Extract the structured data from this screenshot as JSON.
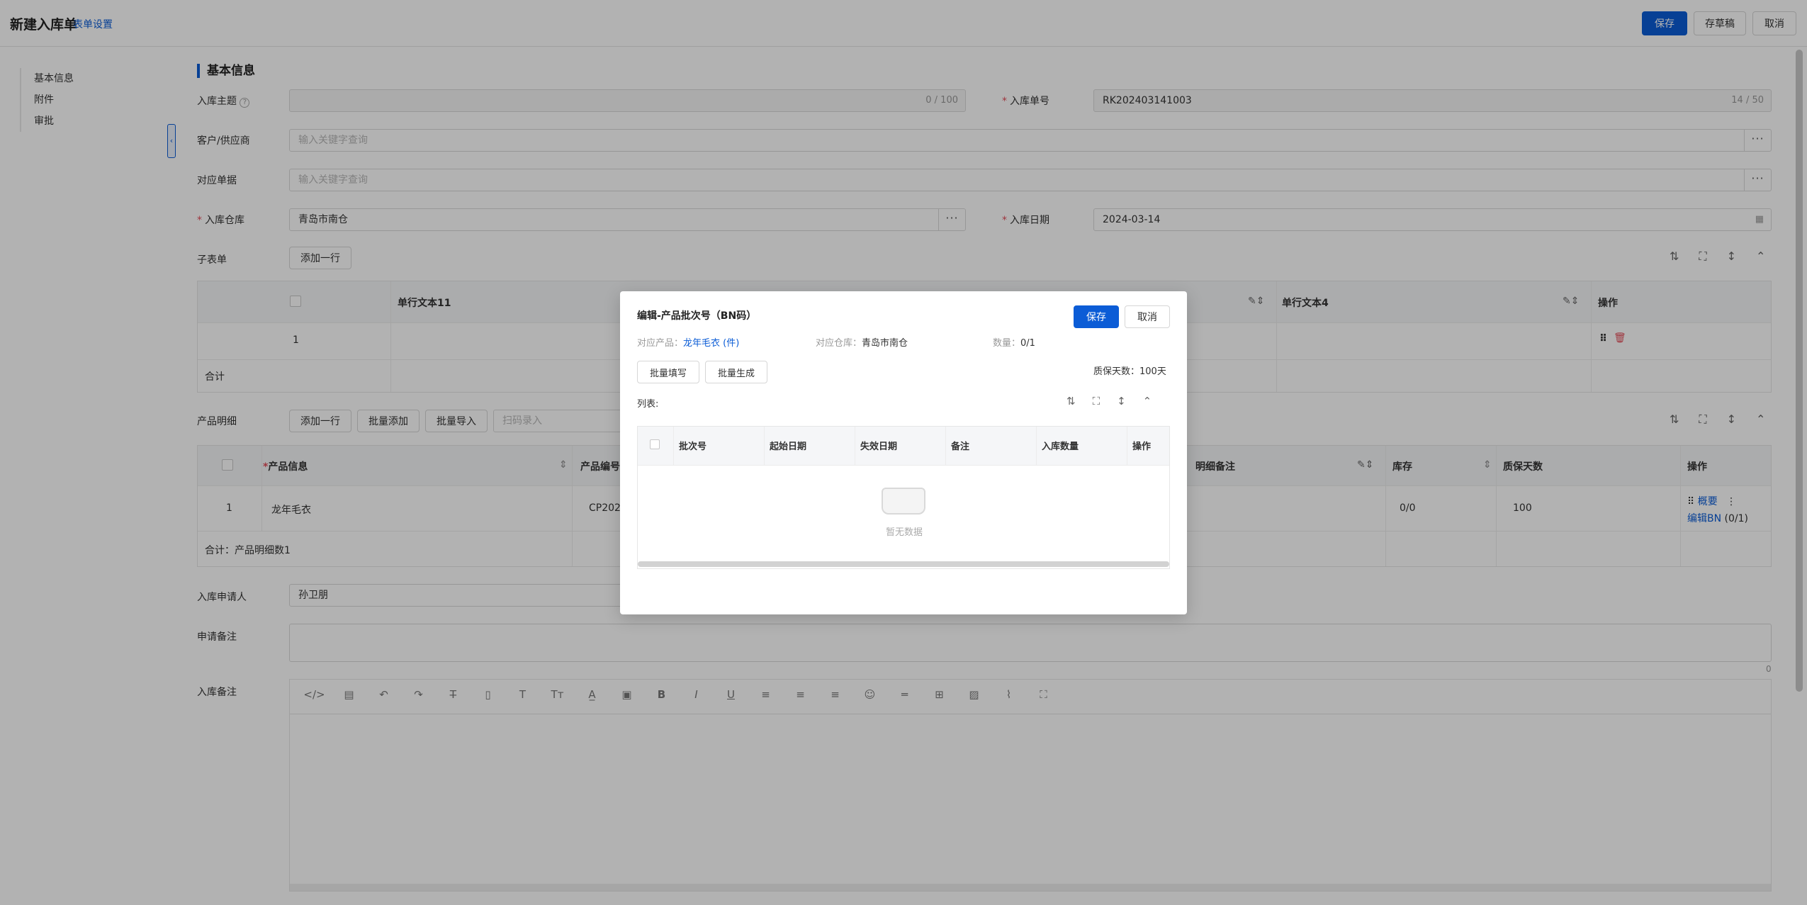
{
  "header": {
    "title": "新建入库单",
    "form_settings": "表单设置",
    "save": "保存",
    "draft": "存草稿",
    "cancel": "取消"
  },
  "sidenav": [
    "基本信息",
    "附件",
    "审批"
  ],
  "section_title": "基本信息",
  "form": {
    "subject_label": "入库主题",
    "subject_count": "0 / 100",
    "order_no_label": "入库单号",
    "order_no_value": "RK202403141003",
    "order_no_count": "14 / 50",
    "partner_label": "客户/供应商",
    "partner_placeholder": "输入关键字查询",
    "doc_label": "对应单据",
    "doc_placeholder": "输入关键字查询",
    "warehouse_label": "入库仓库",
    "warehouse_value": "青岛市南仓",
    "date_label": "入库日期",
    "date_value": "2024-03-14",
    "subform_label": "子表单",
    "add_row": "添加一行",
    "product_label": "产品明细",
    "batch_add": "批量添加",
    "batch_import": "批量导入",
    "scan_placeholder": "扫码录入",
    "applicant_label": "入库申请人",
    "applicant_value": "孙卫朋",
    "apply_note_label": "申请备注",
    "apply_note_count": "0",
    "stock_note_label": "入库备注"
  },
  "subform_table": {
    "col_text11": "单行文本11",
    "col_text4": "单行文本4",
    "col_op": "操作",
    "row_no": "1",
    "total": "合计"
  },
  "product_table": {
    "col_info": "产品信息",
    "col_code": "产品编号",
    "col_note": "明细备注",
    "col_stock": "库存",
    "col_days": "质保天数",
    "col_op": "操作",
    "row_no": "1",
    "row_name": "龙年毛衣",
    "row_code": "CP2024",
    "row_stock": "0/0",
    "row_days": "100",
    "op_summary": "概要",
    "op_edit_bn": "编辑BN",
    "op_edit_count": "(0/1)",
    "total": "合计：产品明细数1"
  },
  "modal": {
    "title": "编辑-产品批次号（BN码）",
    "save": "保存",
    "cancel": "取消",
    "product_label": "对应产品：",
    "product_value": "龙年毛衣 (件)",
    "warehouse_label": "对应仓库：",
    "warehouse_value": "青岛市南仓",
    "qty_label": "数量：",
    "qty_value": "0/1",
    "batch_fill": "批量填写",
    "batch_gen": "批量生成",
    "shelf_days": "质保天数：100天",
    "list_label": "列表:",
    "columns": [
      "批次号",
      "起始日期",
      "失效日期",
      "备注",
      "入库数量",
      "操作"
    ],
    "empty": "暂无数据"
  },
  "colors": {
    "primary": "#0b5cd6",
    "required": "#e34d59"
  }
}
